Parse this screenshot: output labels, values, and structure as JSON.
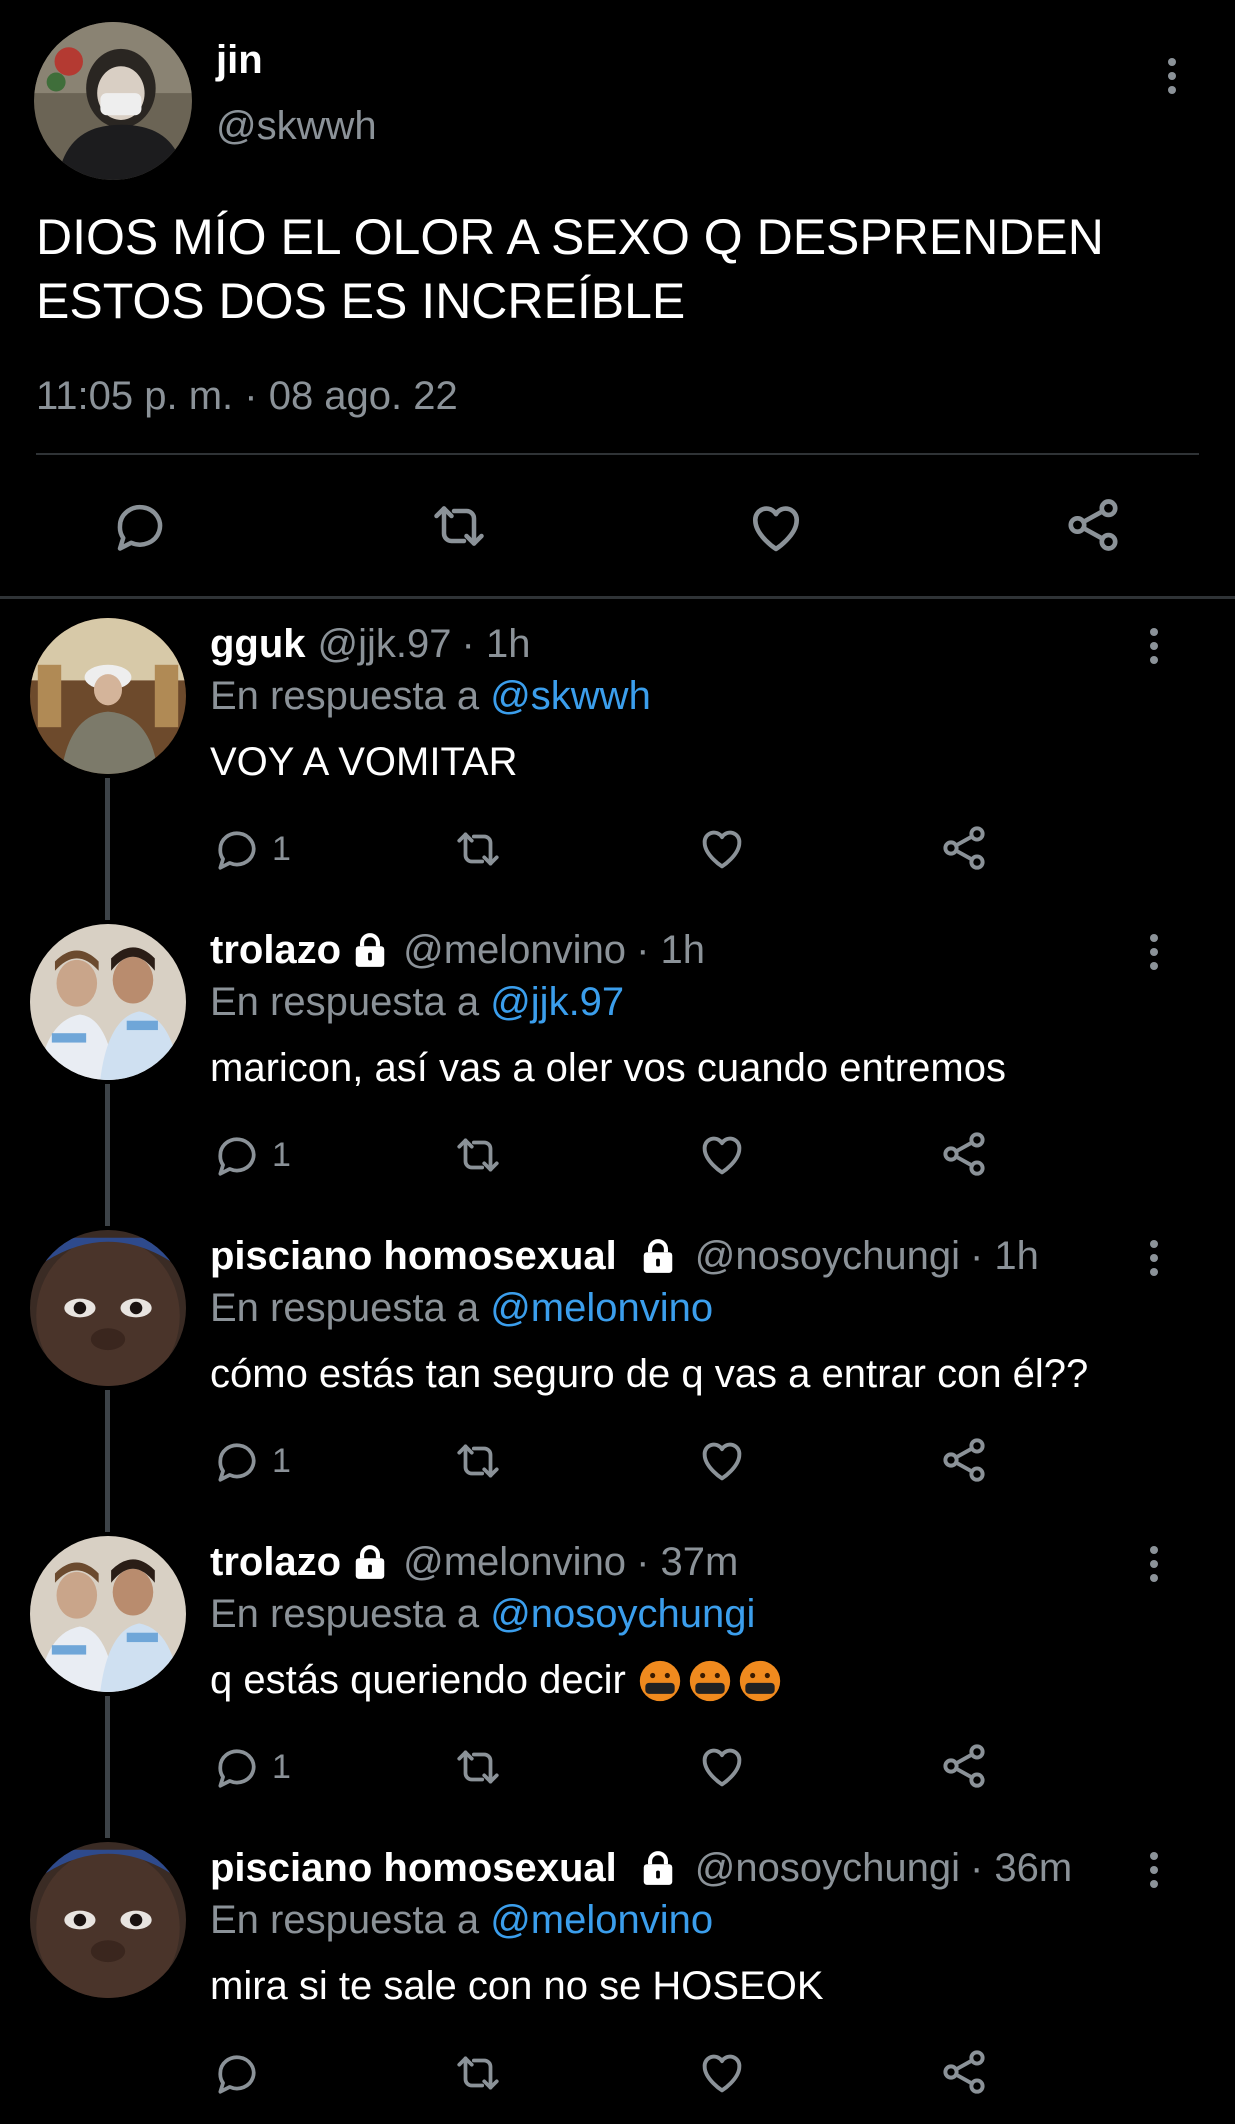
{
  "main_tweet": {
    "display_name": "jin",
    "handle": "@skwwh",
    "text_line1": "DIOS MÍO EL OLOR A SEXO Q DESPRENDEN",
    "text_line2": "ESTOS DOS ES INCREÍBLE",
    "timestamp": "11:05 p. m. · 08 ago. 22"
  },
  "replies": [
    {
      "display_name": "gguk",
      "handle": "@jjk.97",
      "time": "· 1h",
      "reply_prefix": "En respuesta a",
      "reply_to": "@skwwh",
      "text": "VOY A VOMITAR",
      "reply_count": "1",
      "locked": false
    },
    {
      "display_name": "trolazo",
      "handle": "@melonvino",
      "time": "· 1h",
      "reply_prefix": "En respuesta a",
      "reply_to": "@jjk.97",
      "text": "maricon, así vas a oler vos cuando entremos",
      "reply_count": "1",
      "locked": true
    },
    {
      "display_name": "pisciano homosexual",
      "handle": "@nosoychungi",
      "time": "· 1h",
      "reply_prefix": "En respuesta a",
      "reply_to": "@melonvino",
      "text": "cómo estás tan seguro de q vas a entrar con él??",
      "reply_count": "1",
      "locked": true
    },
    {
      "display_name": "trolazo",
      "handle": "@melonvino",
      "time": "· 37m",
      "reply_prefix": "En respuesta a",
      "reply_to": "@nosoychungi",
      "text": "q estás queriendo decir",
      "reply_count": "1",
      "locked": true,
      "emoji": [
        "🤬",
        "🤬",
        "🤬"
      ]
    },
    {
      "display_name": "pisciano homosexual",
      "handle": "@nosoychungi",
      "time": "· 36m",
      "reply_prefix": "En respuesta a",
      "reply_to": "@melonvino",
      "text": "mira si te sale con no se HOSEOK",
      "reply_count": "",
      "locked": true
    }
  ],
  "icons": {
    "reply": "speech-bubble-icon",
    "retweet": "retweet-arrows-icon",
    "like": "heart-icon",
    "share": "share-nodes-icon",
    "more": "vertical-ellipsis-icon",
    "lock": "lock-icon",
    "emoji": "cursing-face-emoji"
  },
  "colors": {
    "background": "#000000",
    "text": "#ffffff",
    "secondary": "#8b9298",
    "link": "#3b9eec",
    "divider": "#2f3336"
  }
}
